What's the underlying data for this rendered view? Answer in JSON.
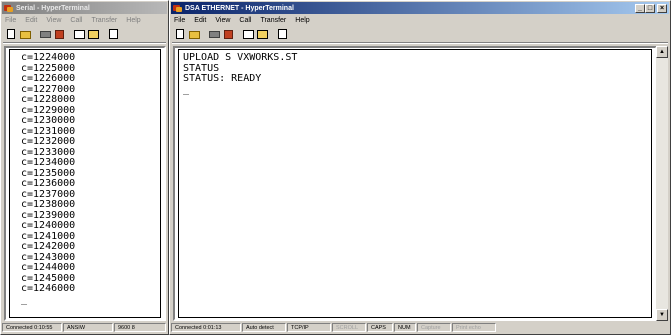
{
  "left_window": {
    "title": "Serial - HyperTerminal",
    "menu": [
      "File",
      "Edit",
      "View",
      "Call",
      "Transfer",
      "Help"
    ],
    "terminal_lines": [
      "c=1224000",
      "c=1225000",
      "c=1226000",
      "c=1227000",
      "c=1228000",
      "c=1229000",
      "c=1230000",
      "c=1231000",
      "c=1232000",
      "c=1233000",
      "c=1234000",
      "c=1235000",
      "c=1236000",
      "c=1237000",
      "c=1238000",
      "c=1239000",
      "c=1240000",
      "c=1241000",
      "c=1242000",
      "c=1243000",
      "c=1244000",
      "c=1245000",
      "c=1246000",
      "_"
    ],
    "status": {
      "connected": "Connected 0:10:55",
      "emulation": "ANSIW",
      "port": "9600 8"
    }
  },
  "right_window": {
    "title": "DSA ETHERNET - HyperTerminal",
    "menu": [
      "File",
      "Edit",
      "View",
      "Call",
      "Transfer",
      "Help"
    ],
    "terminal_lines": [
      "UPLOAD S VXWORKS.ST",
      "STATUS",
      "STATUS: READY",
      "_"
    ],
    "window_buttons": {
      "minimize": "_",
      "maximize": "□",
      "close": "×"
    },
    "status": {
      "connected": "Connected 0:01:13",
      "detect": "Auto detect",
      "protocol": "TCP/IP",
      "scroll": "SCROLL",
      "caps": "CAPS",
      "num": "NUM",
      "capture": "Capture",
      "print_echo": "Print echo"
    }
  },
  "icons": [
    "new-icon",
    "open-icon",
    "properties-icon",
    "disconnect-icon",
    "send-icon",
    "receive-icon",
    "scroll-up-icon",
    "scroll-down-icon"
  ]
}
